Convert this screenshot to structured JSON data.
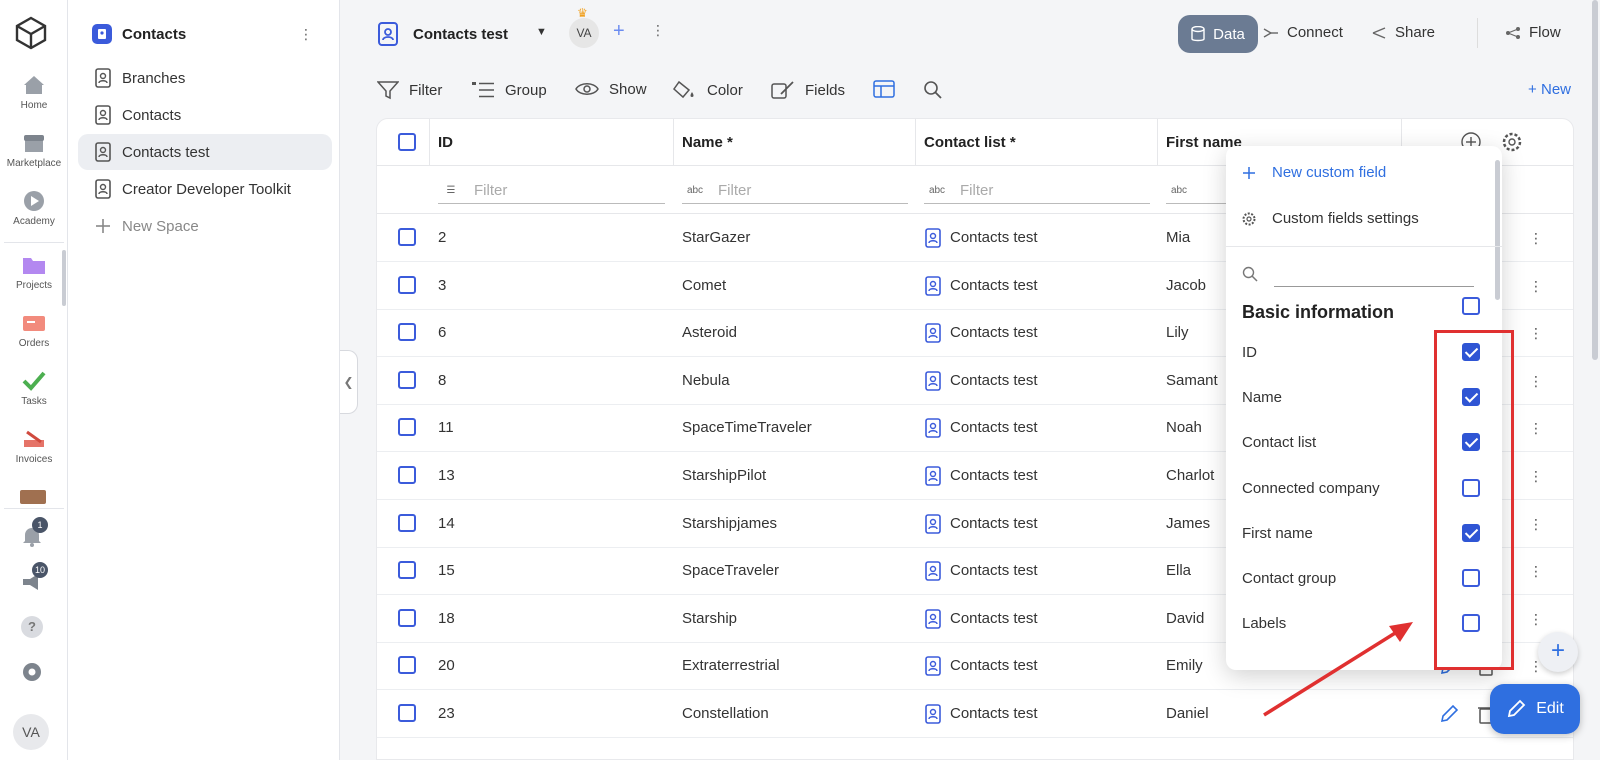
{
  "rail": {
    "items": [
      {
        "label": "Home",
        "icon": "home-icon"
      },
      {
        "label": "Marketplace",
        "icon": "store-icon"
      },
      {
        "label": "Academy",
        "icon": "play-icon"
      },
      {
        "label": "Projects",
        "icon": "folder-icon"
      },
      {
        "label": "Orders",
        "icon": "orders-icon"
      },
      {
        "label": "Tasks",
        "icon": "check-icon"
      },
      {
        "label": "Invoices",
        "icon": "invoice-icon"
      }
    ],
    "notifications_count": "1",
    "announcements_count": "10",
    "avatar": "VA"
  },
  "sidebar": {
    "title": "Contacts",
    "items": [
      {
        "label": "Branches"
      },
      {
        "label": "Contacts"
      },
      {
        "label": "Contacts test",
        "active": true
      },
      {
        "label": "Creator Developer Toolkit"
      }
    ],
    "new_space": "New Space"
  },
  "topbar": {
    "title": "Contacts test",
    "avatar": "VA",
    "data_label": "Data",
    "connect_label": "Connect",
    "share_label": "Share",
    "flow_label": "Flow"
  },
  "toolbar": {
    "filter": "Filter",
    "group": "Group",
    "show": "Show",
    "color": "Color",
    "fields": "Fields",
    "new": "New"
  },
  "table": {
    "columns": [
      "ID",
      "Name *",
      "Contact list *",
      "First name"
    ],
    "filter_placeholder": "Filter",
    "rows": [
      {
        "id": "2",
        "name": "StarGazer",
        "list": "Contacts test",
        "first": "Mia"
      },
      {
        "id": "3",
        "name": "Comet",
        "list": "Contacts test",
        "first": "Jacob"
      },
      {
        "id": "6",
        "name": "Asteroid",
        "list": "Contacts test",
        "first": "Lily"
      },
      {
        "id": "8",
        "name": "Nebula",
        "list": "Contacts test",
        "first": "Samant"
      },
      {
        "id": "11",
        "name": "SpaceTimeTraveler",
        "list": "Contacts test",
        "first": "Noah"
      },
      {
        "id": "13",
        "name": "StarshipPilot",
        "list": "Contacts test",
        "first": "Charlot"
      },
      {
        "id": "14",
        "name": "Starshipjames",
        "list": "Contacts test",
        "first": "James"
      },
      {
        "id": "15",
        "name": "SpaceTraveler",
        "list": "Contacts test",
        "first": "Ella"
      },
      {
        "id": "18",
        "name": "Starship",
        "list": "Contacts test",
        "first": "David"
      },
      {
        "id": "20",
        "name": "Extraterrestrial",
        "list": "Contacts test",
        "first": "Emily"
      },
      {
        "id": "23",
        "name": "Constellation",
        "list": "Contacts test",
        "first": "Daniel"
      }
    ]
  },
  "dropdown": {
    "new_custom_field": "New custom field",
    "custom_fields_settings": "Custom fields settings",
    "section": "Basic information",
    "fields": [
      {
        "label": "ID",
        "checked": true
      },
      {
        "label": "Name",
        "checked": true
      },
      {
        "label": "Contact list",
        "checked": true
      },
      {
        "label": "Connected company",
        "checked": false
      },
      {
        "label": "First name",
        "checked": true
      },
      {
        "label": "Contact group",
        "checked": false
      },
      {
        "label": "Labels",
        "checked": false
      }
    ]
  },
  "edit_button": "Edit",
  "colors": {
    "accent": "#2f6fe0",
    "checkbox": "#3b5bdb",
    "highlight": "#e03030",
    "data_pill": "#6b7b93"
  }
}
